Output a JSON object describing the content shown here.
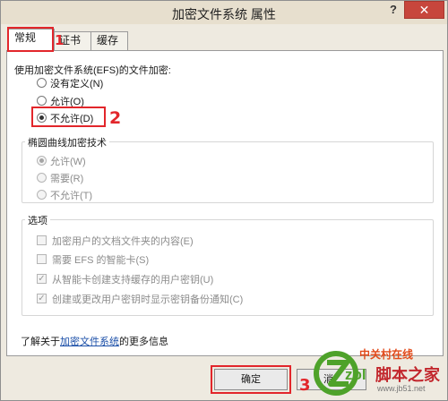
{
  "window": {
    "title": "加密文件系统 属性",
    "help_label": "?",
    "close_label": "✕"
  },
  "tabs": [
    {
      "label": "常规",
      "active": true
    },
    {
      "label": "证书",
      "active": false
    },
    {
      "label": "缓存",
      "active": false
    }
  ],
  "efs": {
    "heading": "使用加密文件系统(EFS)的文件加密:",
    "options": [
      {
        "label": "没有定义(N)",
        "checked": false
      },
      {
        "label": "允许(O)",
        "checked": false
      },
      {
        "label": "不允许(D)",
        "checked": true
      }
    ]
  },
  "ecc": {
    "title": "椭圆曲线加密技术",
    "options": [
      {
        "label": "允许(W)",
        "checked": true
      },
      {
        "label": "需要(R)",
        "checked": false
      },
      {
        "label": "不允许(T)",
        "checked": false
      }
    ]
  },
  "options_group": {
    "title": "选项",
    "items": [
      {
        "label": "加密用户的文档文件夹的内容(E)",
        "checked": false
      },
      {
        "label": "需要 EFS 的智能卡(S)",
        "checked": false
      },
      {
        "label": "从智能卡创建支持缓存的用户密钥(U)",
        "checked": true
      },
      {
        "label": "创建或更改用户密钥时显示密钥备份通知(C)",
        "checked": true
      }
    ]
  },
  "footer": {
    "prefix": "了解关于",
    "link": "加密文件系统",
    "suffix": "的更多信息"
  },
  "buttons": {
    "ok": "确定",
    "cancel_partial": "消"
  },
  "annotations": {
    "n1": "1",
    "n2": "2",
    "n3": "3"
  },
  "watermark": {
    "brand_cn": "中关村在线",
    "brand_en": "zol",
    "site_cn": "脚本之家",
    "site_url": "www.jb51.net"
  },
  "colors": {
    "annotation_red": "#e2262b",
    "close_red": "#c7463c",
    "link_blue": "#1b4fa8"
  }
}
